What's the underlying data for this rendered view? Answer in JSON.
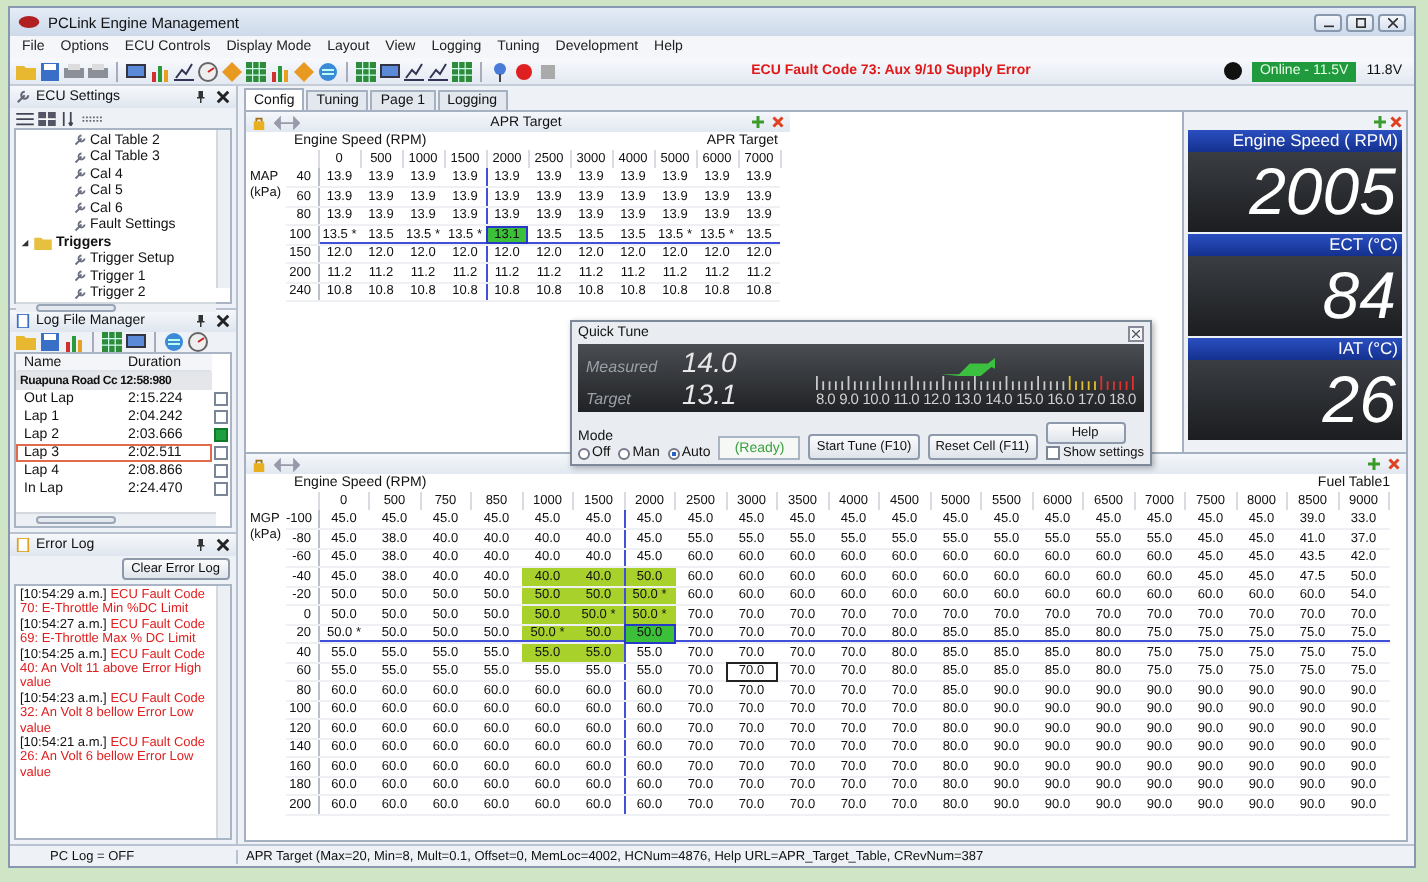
{
  "window": {
    "title": "PCLink Engine Management"
  },
  "menu": [
    "File",
    "Options",
    "ECU Controls",
    "Display Mode",
    "Layout",
    "View",
    "Logging",
    "Tuning",
    "Development",
    "Help"
  ],
  "toolbar": {
    "fault_message": "ECU Fault Code 73: Aux 9/10 Supply Error",
    "connection": "Online - 11.5V",
    "voltage": "11.8V"
  },
  "ecu_settings": {
    "title": "ECU Settings",
    "tree": [
      {
        "label": "Cal Table 2",
        "kind": "setting"
      },
      {
        "label": "Cal Table 3",
        "kind": "setting"
      },
      {
        "label": "Cal 4",
        "kind": "setting"
      },
      {
        "label": "Cal 5",
        "kind": "setting"
      },
      {
        "label": "Cal 6",
        "kind": "setting"
      },
      {
        "label": "Fault Settings",
        "kind": "setting"
      },
      {
        "label": "Triggers",
        "kind": "folder",
        "expanded": true,
        "children": [
          {
            "label": "Trigger Setup",
            "kind": "setting"
          },
          {
            "label": "Trigger 1",
            "kind": "setting"
          },
          {
            "label": "Trigger 2",
            "kind": "setting"
          }
        ]
      }
    ]
  },
  "log_manager": {
    "title": "Log File Manager",
    "columns": [
      "Name",
      "Duration"
    ],
    "group": "Ruapuna Road Cc 12:58:980",
    "laps": [
      {
        "name": "Out Lap",
        "duration": "2:15.224",
        "checked": false,
        "selected": false
      },
      {
        "name": "Lap 1",
        "duration": "2:04.242",
        "checked": false,
        "selected": false
      },
      {
        "name": "Lap 2",
        "duration": "2:03.666",
        "checked": true,
        "selected": false
      },
      {
        "name": "Lap 3",
        "duration": "2:02.511",
        "checked": false,
        "selected": true
      },
      {
        "name": "Lap 4",
        "duration": "2:08.866",
        "checked": false,
        "selected": false
      },
      {
        "name": "In Lap",
        "duration": "2:24.470",
        "checked": false,
        "selected": false
      }
    ]
  },
  "error_log": {
    "title": "Error Log",
    "clear_button": "Clear Error Log",
    "entries": [
      {
        "time": "[10:54:29 a.m.]",
        "message": "ECU Fault Code 70: E-Throttle Min %DC Limit"
      },
      {
        "time": "[10:54:27 a.m.]",
        "message": "ECU Fault Code 69: E-Throttle Max % DC Limit"
      },
      {
        "time": "[10:54:25 a.m.]",
        "message": "ECU Fault Code 40: An Volt 11 above Error High value"
      },
      {
        "time": "[10:54:23 a.m.]",
        "message": "ECU Fault Code 32: An Volt 8 bellow Error Low value"
      },
      {
        "time": "[10:54:21 a.m.]",
        "message": "ECU Fault Code 26: An Volt 6 bellow Error Low value"
      }
    ]
  },
  "tabs": [
    {
      "label": "Config",
      "selected": true
    },
    {
      "label": "Tuning",
      "selected": false
    },
    {
      "label": "Page 1",
      "selected": false
    },
    {
      "label": "Logging",
      "selected": false
    }
  ],
  "apr_table": {
    "title": "APR Target",
    "x_label": "Engine Speed (RPM)",
    "value_label": "APR Target",
    "y_label": "MAP (kPa)",
    "columns": [
      "0",
      "500",
      "1000",
      "1500",
      "2000",
      "2500",
      "3000",
      "4000",
      "5000",
      "6000",
      "7000"
    ],
    "rows": [
      {
        "label": "40",
        "cells": [
          "13.9",
          "13.9",
          "13.9",
          "13.9",
          "13.9",
          "13.9",
          "13.9",
          "13.9",
          "13.9",
          "13.9",
          "13.9"
        ]
      },
      {
        "label": "60",
        "cells": [
          "13.9",
          "13.9",
          "13.9",
          "13.9",
          "13.9",
          "13.9",
          "13.9",
          "13.9",
          "13.9",
          "13.9",
          "13.9"
        ]
      },
      {
        "label": "80",
        "cells": [
          "13.9",
          "13.9",
          "13.9",
          "13.9",
          "13.9",
          "13.9",
          "13.9",
          "13.9",
          "13.9",
          "13.9",
          "13.9"
        ]
      },
      {
        "label": "100",
        "cells": [
          "13.5 *",
          "13.5",
          "13.5 *",
          "13.5 *",
          {
            "value": "13.1",
            "selected": true
          },
          "13.5",
          "13.5",
          "13.5",
          "13.5 *",
          "13.5 *",
          "13.5"
        ]
      },
      {
        "label": "150",
        "cells": [
          "12.0",
          "12.0",
          "12.0",
          "12.0",
          "12.0",
          "12.0",
          "12.0",
          "12.0",
          "12.0",
          "12.0",
          "12.0"
        ]
      },
      {
        "label": "200",
        "cells": [
          "11.2",
          "11.2",
          "11.2",
          "11.2",
          "11.2",
          "11.2",
          "11.2",
          "11.2",
          "11.2",
          "11.2",
          "11.2"
        ]
      },
      {
        "label": "240",
        "cells": [
          "10.8",
          "10.8",
          "10.8",
          "10.8",
          "10.8",
          "10.8",
          "10.8",
          "10.8",
          "10.8",
          "10.8",
          "10.8"
        ]
      }
    ]
  },
  "gauges": [
    {
      "label": "Engine Speed ( RPM)",
      "value": "2005"
    },
    {
      "label": "ECT (°C)",
      "value": "84"
    },
    {
      "label": "IAT (°C)",
      "value": "26"
    }
  ],
  "quick_tune": {
    "title": "Quick Tune",
    "measured_label": "Measured",
    "measured": "14.0",
    "target_label": "Target",
    "target": "13.1",
    "scale": [
      "8.0",
      "9.0",
      "10.0",
      "11.0",
      "12.0",
      "13.0",
      "14.0",
      "15.0",
      "16.0",
      "17.0",
      "18.0"
    ],
    "mode_label": "Mode",
    "modes": [
      {
        "label": "Off",
        "selected": false
      },
      {
        "label": "Man",
        "selected": false
      },
      {
        "label": "Auto",
        "selected": true
      }
    ],
    "status": "(Ready)",
    "buttons": [
      "Start Tune (F10)",
      "Reset Cell (F11)",
      "Help"
    ],
    "show_settings": {
      "label": "Show settings",
      "checked": false
    }
  },
  "fuel_table": {
    "title": "Fuel Table1",
    "x_label": "Engine Speed (RPM)",
    "y_label": "MGP (kPa)",
    "columns": [
      "0",
      "500",
      "750",
      "850",
      "1000",
      "1500",
      "2000",
      "2500",
      "3000",
      "3500",
      "4000",
      "4500",
      "5000",
      "5500",
      "6000",
      "6500",
      "7000",
      "7500",
      "8000",
      "8500",
      "9000"
    ],
    "rows": [
      {
        "label": "-100",
        "cells": [
          "45.0",
          "45.0",
          "45.0",
          "45.0",
          "45.0",
          "45.0",
          "45.0",
          "45.0",
          "45.0",
          "45.0",
          "45.0",
          "45.0",
          "45.0",
          "45.0",
          "45.0",
          "45.0",
          "45.0",
          "45.0",
          "45.0",
          "39.0",
          "33.0"
        ]
      },
      {
        "label": "-80",
        "cells": [
          "45.0",
          "38.0",
          "40.0",
          "40.0",
          "40.0",
          "40.0",
          "45.0",
          "55.0",
          "55.0",
          "55.0",
          "55.0",
          "55.0",
          "55.0",
          "55.0",
          "55.0",
          "55.0",
          "55.0",
          "45.0",
          "45.0",
          "41.0",
          "37.0"
        ]
      },
      {
        "label": "-60",
        "cells": [
          "45.0",
          "38.0",
          "40.0",
          "40.0",
          "40.0",
          "40.0",
          "45.0",
          "60.0",
          "60.0",
          "60.0",
          "60.0",
          "60.0",
          "60.0",
          "60.0",
          "60.0",
          "60.0",
          "60.0",
          "45.0",
          "45.0",
          "43.5",
          "42.0"
        ]
      },
      {
        "label": "-40",
        "cells": [
          "45.0",
          "38.0",
          "40.0",
          "40.0",
          {
            "value": "40.0",
            "highlighted": true
          },
          {
            "value": "40.0",
            "highlighted": true
          },
          {
            "value": "50.0",
            "highlighted": true
          },
          "60.0",
          "60.0",
          "60.0",
          "60.0",
          "60.0",
          "60.0",
          "60.0",
          "60.0",
          "60.0",
          "60.0",
          "45.0",
          "45.0",
          "47.5",
          "50.0"
        ]
      },
      {
        "label": "-20",
        "cells": [
          "50.0",
          "50.0",
          "50.0",
          "50.0",
          {
            "value": "50.0",
            "highlighted": true
          },
          {
            "value": "50.0",
            "highlighted": true
          },
          {
            "value": "50.0 *",
            "highlighted": true
          },
          "60.0",
          "60.0",
          "60.0",
          "60.0",
          "60.0",
          "60.0",
          "60.0",
          "60.0",
          "60.0",
          "60.0",
          "60.0",
          "60.0",
          "60.0",
          "54.0"
        ]
      },
      {
        "label": "0",
        "cells": [
          "50.0",
          "50.0",
          "50.0",
          "50.0",
          {
            "value": "50.0",
            "highlighted": true
          },
          {
            "value": "50.0 *",
            "highlighted": true
          },
          {
            "value": "50.0 *",
            "highlighted": true
          },
          "70.0",
          "70.0",
          "70.0",
          "70.0",
          "70.0",
          "70.0",
          "70.0",
          "70.0",
          "70.0",
          "70.0",
          "70.0",
          "70.0",
          "70.0",
          "70.0"
        ]
      },
      {
        "label": "20",
        "cells": [
          "50.0 *",
          "50.0",
          "50.0",
          "50.0",
          {
            "value": "50.0 *",
            "highlighted": true
          },
          {
            "value": "50.0",
            "highlighted": true
          },
          {
            "value": "50.0",
            "selected": true
          },
          "70.0",
          "70.0",
          "70.0",
          "70.0",
          "80.0",
          "85.0",
          "85.0",
          "85.0",
          "80.0",
          "75.0",
          "75.0",
          "75.0",
          "75.0",
          "75.0"
        ]
      },
      {
        "label": "40",
        "cells": [
          "55.0",
          "55.0",
          "55.0",
          "55.0",
          {
            "value": "55.0",
            "highlighted": true
          },
          {
            "value": "55.0",
            "highlighted": true
          },
          "55.0",
          "70.0",
          "70.0",
          "70.0",
          "70.0",
          "80.0",
          "85.0",
          "85.0",
          "85.0",
          "80.0",
          "75.0",
          "75.0",
          "75.0",
          "75.0",
          "75.0"
        ]
      },
      {
        "label": "60",
        "cells": [
          "55.0",
          "55.0",
          "55.0",
          "55.0",
          "55.0",
          "55.0",
          "55.0",
          "70.0",
          {
            "value": "70.0",
            "outlined": true
          },
          "70.0",
          "70.0",
          "80.0",
          "85.0",
          "85.0",
          "85.0",
          "80.0",
          "75.0",
          "75.0",
          "75.0",
          "75.0",
          "75.0"
        ]
      },
      {
        "label": "80",
        "cells": [
          "60.0",
          "60.0",
          "60.0",
          "60.0",
          "60.0",
          "60.0",
          "60.0",
          "70.0",
          "70.0",
          "70.0",
          "70.0",
          "70.0",
          "85.0",
          "90.0",
          "90.0",
          "90.0",
          "90.0",
          "90.0",
          "90.0",
          "90.0",
          "90.0"
        ]
      },
      {
        "label": "100",
        "cells": [
          "60.0",
          "60.0",
          "60.0",
          "60.0",
          "60.0",
          "60.0",
          "60.0",
          "70.0",
          "70.0",
          "70.0",
          "70.0",
          "70.0",
          "80.0",
          "90.0",
          "90.0",
          "90.0",
          "90.0",
          "90.0",
          "90.0",
          "90.0",
          "90.0"
        ]
      },
      {
        "label": "120",
        "cells": [
          "60.0",
          "60.0",
          "60.0",
          "60.0",
          "60.0",
          "60.0",
          "60.0",
          "70.0",
          "70.0",
          "70.0",
          "70.0",
          "70.0",
          "80.0",
          "90.0",
          "90.0",
          "90.0",
          "90.0",
          "90.0",
          "90.0",
          "90.0",
          "90.0"
        ]
      },
      {
        "label": "140",
        "cells": [
          "60.0",
          "60.0",
          "60.0",
          "60.0",
          "60.0",
          "60.0",
          "60.0",
          "70.0",
          "70.0",
          "70.0",
          "70.0",
          "70.0",
          "80.0",
          "90.0",
          "90.0",
          "90.0",
          "90.0",
          "90.0",
          "90.0",
          "90.0",
          "90.0"
        ]
      },
      {
        "label": "160",
        "cells": [
          "60.0",
          "60.0",
          "60.0",
          "60.0",
          "60.0",
          "60.0",
          "60.0",
          "70.0",
          "70.0",
          "70.0",
          "70.0",
          "70.0",
          "80.0",
          "90.0",
          "90.0",
          "90.0",
          "90.0",
          "90.0",
          "90.0",
          "90.0",
          "90.0"
        ]
      },
      {
        "label": "180",
        "cells": [
          "60.0",
          "60.0",
          "60.0",
          "60.0",
          "60.0",
          "60.0",
          "60.0",
          "70.0",
          "70.0",
          "70.0",
          "70.0",
          "70.0",
          "80.0",
          "90.0",
          "90.0",
          "90.0",
          "90.0",
          "90.0",
          "90.0",
          "90.0",
          "90.0"
        ]
      },
      {
        "label": "200",
        "cells": [
          "60.0",
          "60.0",
          "60.0",
          "60.0",
          "60.0",
          "60.0",
          "60.0",
          "70.0",
          "70.0",
          "70.0",
          "70.0",
          "70.0",
          "80.0",
          "90.0",
          "90.0",
          "90.0",
          "90.0",
          "90.0",
          "90.0",
          "90.0",
          "90.0"
        ]
      }
    ]
  },
  "status_bar": {
    "log": "PC Log = OFF",
    "info": "APR Target (Max=20, Min=8, Mult=0.1, Offset=0, MemLoc=4002, HCNum=4876, Help URL=APR_Target_Table, CRevNum=387"
  }
}
